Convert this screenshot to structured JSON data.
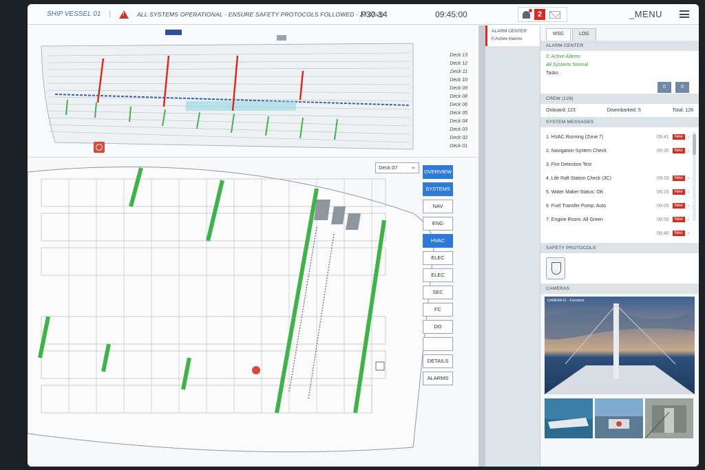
{
  "topbar": {
    "vessel": "SHIP VESSEL 01",
    "status": "ALL SYSTEMS OPERATIONAL - ENSURE SAFETY PROTOCOLS FOLLOWED - 23:07:29",
    "code": "P30-14",
    "clock": "09:45:00",
    "alarm_count": "2",
    "menu_label": "_MENU"
  },
  "decks": [
    "Deck 13",
    "Deck 12",
    "Deck 11",
    "Deck 10",
    "Deck 09",
    "Deck 08",
    "Deck 06",
    "Deck 05",
    "Deck 04",
    "Deck 03",
    "Deck 02",
    "Deck 01"
  ],
  "deck_select": "Deck 07",
  "side_buttons": [
    "OVERVIEW",
    "SYSTEMS",
    "NAV",
    "ENG",
    "HVAC",
    "ELEC",
    "ELEC",
    "SEC",
    "FC",
    "DO",
    "",
    "DETAILS",
    "ALARMS"
  ],
  "alarm_column": {
    "title": "ALARM CENTER",
    "subtitle": "0 Active Alarms"
  },
  "right_panel": {
    "tabs": [
      "MSG",
      "LOG"
    ],
    "alarm_center": {
      "title": "ALARM CENTER",
      "active": "0. Active Alarms",
      "normal": "All Systems Normal",
      "tasks_label": "Tasks",
      "task_a": "0",
      "task_b": "0"
    },
    "crew": {
      "title": "CREW (128)",
      "onboard": "Onboard: 123",
      "disembarked": "Disembarked: 5",
      "total": "Total: 128"
    },
    "system_messages": {
      "title": "SYSTEM MESSAGES",
      "items": [
        {
          "text": "1.  HVAC Running (Zone 7)",
          "time": "09:41",
          "badge": "New"
        },
        {
          "text": "2.  Navigation System Check",
          "time": "09:35",
          "badge": "New"
        },
        {
          "text": "3.  Fire Detection Test",
          "time": "",
          "badge": ""
        },
        {
          "text": "4.  Life Raft Station Check (3C)",
          "time": "09:20",
          "badge": "New"
        },
        {
          "text": "5.  Water Maker Status: OK",
          "time": "09:15",
          "badge": "New"
        },
        {
          "text": "6.  Fuel Transfer Pump: Auto",
          "time": "09:05",
          "badge": "New"
        },
        {
          "text": "7.  Engine Room: All Green",
          "time": "08:50",
          "badge": "New"
        },
        {
          "text": "",
          "time": "08:40",
          "badge": "New"
        }
      ]
    },
    "safety_title": "SAFETY PROTOCOLS",
    "cameras_title": "CAMERAS",
    "camera_main_label": "CAMERA 01 - Foredeck"
  },
  "colors": {
    "accent_blue": "#2f7ad6",
    "alarm_red": "#d62c24",
    "ok_green": "#2e9c3a",
    "zone_green": "#3fb34a"
  }
}
